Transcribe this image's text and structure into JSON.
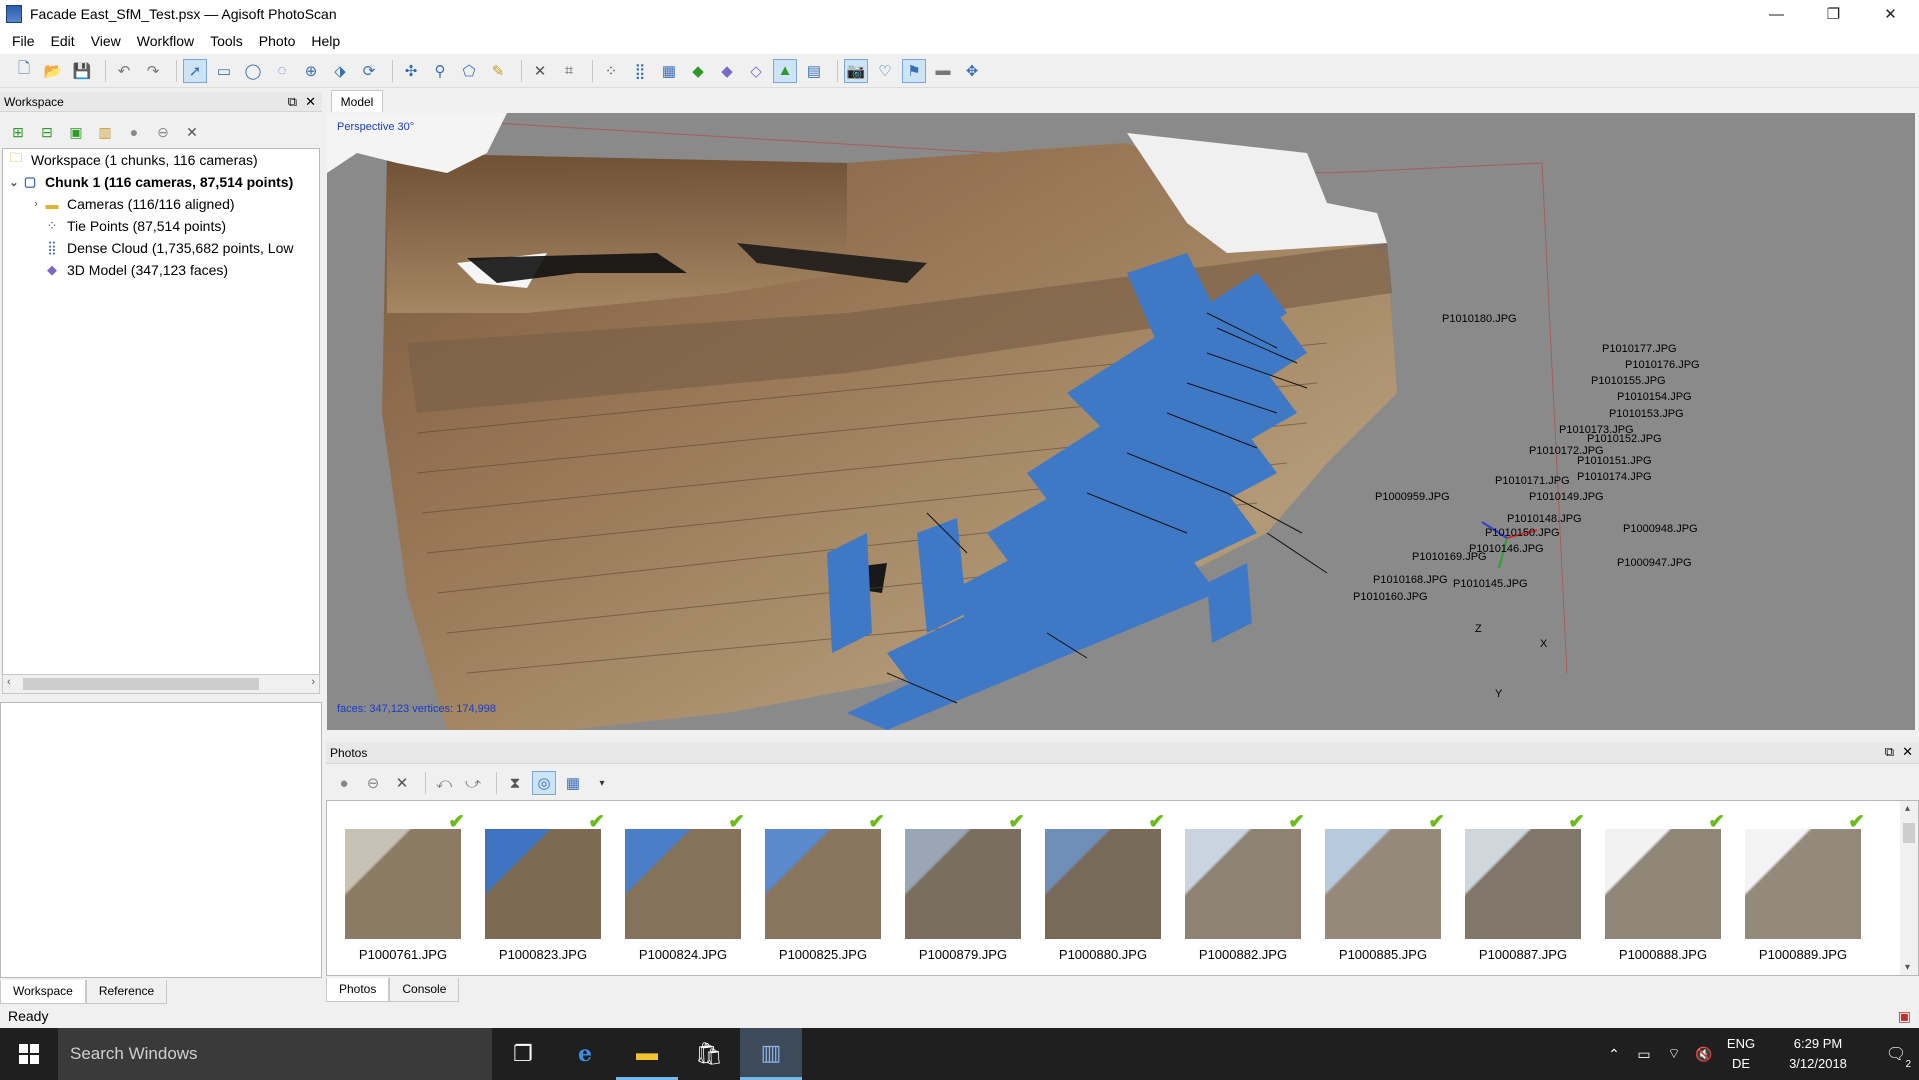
{
  "window": {
    "title": "Facade East_SfM_Test.psx — Agisoft PhotoScan",
    "minimize": "—",
    "maximize": "❐",
    "close": "✕"
  },
  "menu": [
    "File",
    "Edit",
    "View",
    "Workflow",
    "Tools",
    "Photo",
    "Help"
  ],
  "workspace": {
    "panel_title": "Workspace",
    "tree": [
      {
        "label": "Workspace (1 chunks, 116 cameras)",
        "icon": "workspace-icon"
      },
      {
        "label": "Chunk 1 (116 cameras, 87,514 points)",
        "icon": "chunk-icon"
      },
      {
        "label": "Cameras (116/116 aligned)",
        "icon": "folder-icon"
      },
      {
        "label": "Tie Points (87,514 points)",
        "icon": "tie-points-icon"
      },
      {
        "label": "Dense Cloud (1,735,682 points, Low",
        "icon": "dense-cloud-icon"
      },
      {
        "label": "3D Model (347,123 faces)",
        "icon": "model-icon"
      }
    ],
    "tabs": [
      "Workspace",
      "Reference"
    ]
  },
  "model": {
    "tab": "Model",
    "projection": "Perspective 30°",
    "stats": "faces: 347,123 vertices: 174,998",
    "axes": {
      "x": "X",
      "y": "Y",
      "z": "Z"
    },
    "camera_labels": [
      "P1010180.JPG",
      "P1010177.JPG",
      "P1010176.JPG",
      "P1010155.JPG",
      "P1010154.JPG",
      "P1010153.JPG",
      "P1010173.JPG",
      "P1010152.JPG",
      "P1010172.JPG",
      "P1010151.JPG",
      "P1010149.JPG",
      "P1010148.JPG",
      "P1010146.JPG",
      "P1010145.JPG",
      "P1010169.JPG",
      "P1010168.JPG",
      "P1000959.JPG",
      "P1000948.JPG",
      "P1000947.JPG",
      "P1010160.JPG",
      "P1010171.JPG",
      "P1010174.JPG",
      "P1010150.JPG"
    ]
  },
  "photos": {
    "panel_title": "Photos",
    "items": [
      {
        "name": "P1000761.JPG",
        "sky": "#c8c2b6",
        "wall": "#8b7a64"
      },
      {
        "name": "P1000823.JPG",
        "sky": "#3f73c2",
        "wall": "#7d6a52"
      },
      {
        "name": "P1000824.JPG",
        "sky": "#4a7ec7",
        "wall": "#86725a"
      },
      {
        "name": "P1000825.JPG",
        "sky": "#5a89cc",
        "wall": "#8a765e"
      },
      {
        "name": "P1000879.JPG",
        "sky": "#9aa6b4",
        "wall": "#7a6e5e"
      },
      {
        "name": "P1000880.JPG",
        "sky": "#6f8fb8",
        "wall": "#776a58"
      },
      {
        "name": "P1000882.JPG",
        "sky": "#c9d4e0",
        "wall": "#8e8272"
      },
      {
        "name": "P1000885.JPG",
        "sky": "#b7c9dd",
        "wall": "#958a7a"
      },
      {
        "name": "P1000887.JPG",
        "sky": "#cfd6dc",
        "wall": "#80766a"
      },
      {
        "name": "P1000888.JPG",
        "sky": "#f2f2f2",
        "wall": "#8f8678"
      },
      {
        "name": "P1000889.JPG",
        "sky": "#f4f4f4",
        "wall": "#948a7c"
      }
    ],
    "tabs": [
      "Photos",
      "Console"
    ]
  },
  "status": "Ready",
  "taskbar": {
    "search_placeholder": "Search Windows",
    "lang_top": "ENG",
    "lang_bottom": "DE",
    "time": "6:29 PM",
    "date": "3/12/2018",
    "notifications": "2"
  },
  "colors": {
    "camera_blue": "#3f79c6",
    "check_green": "#6dbb1d",
    "viewport_bg": "#8a8a8a"
  }
}
